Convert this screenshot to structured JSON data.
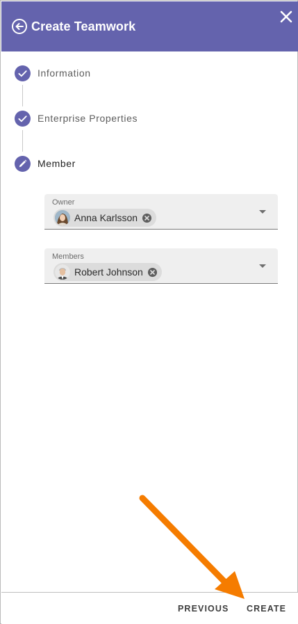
{
  "header": {
    "title": "Create Teamwork",
    "back_icon": "arrow-left-circle-icon",
    "close_icon": "close-icon",
    "color": "#6463ad"
  },
  "steps": [
    {
      "label": "Information",
      "status": "completed",
      "icon": "check-icon"
    },
    {
      "label": "Enterprise Properties",
      "status": "completed",
      "icon": "check-icon"
    },
    {
      "label": "Member",
      "status": "active",
      "icon": "pencil-icon"
    }
  ],
  "fields": {
    "owner": {
      "label": "Owner",
      "chips": [
        {
          "name": "Anna Karlsson"
        }
      ]
    },
    "members": {
      "label": "Members",
      "chips": [
        {
          "name": "Robert Johnson"
        }
      ]
    }
  },
  "footer": {
    "previous_label": "PREVIOUS",
    "create_label": "CREATE"
  },
  "annotation": {
    "color": "#f57c00",
    "points_to": "create-button"
  }
}
